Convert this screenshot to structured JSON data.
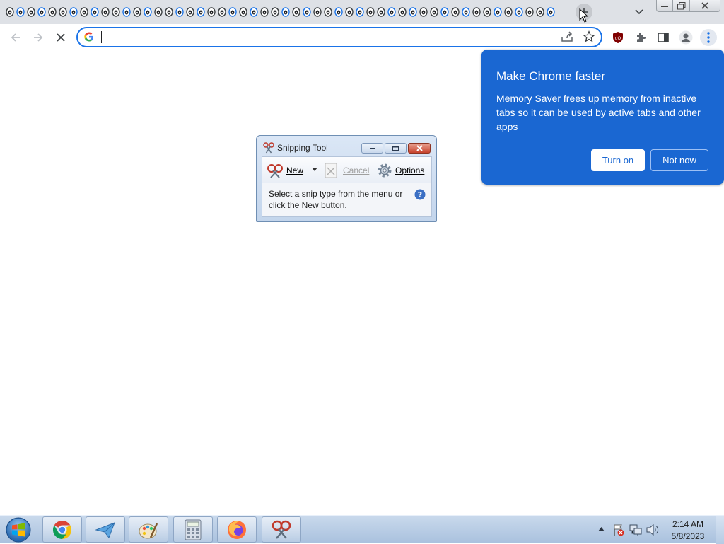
{
  "browser": {
    "tab_count": 52,
    "omnibox": {
      "value": "",
      "placeholder": ""
    }
  },
  "memory_saver": {
    "title": "Make Chrome faster",
    "body": "Memory Saver frees up memory from inactive tabs so it can be used by active tabs and other apps",
    "turn_on_label": "Turn on",
    "not_now_label": "Not now",
    "accent": "#1a67d2"
  },
  "snipping_tool": {
    "title": "Snipping Tool",
    "new_label": "New",
    "cancel_label": "Cancel",
    "options_label": "Options",
    "message": "Select a snip type from the menu or click the New button."
  },
  "taskbar": {
    "apps": [
      "chrome-icon",
      "send-app-icon",
      "paint-icon",
      "calculator-icon",
      "firefox-icon",
      "snipping-tool-icon"
    ],
    "time": "2:14 AM",
    "date": "5/8/2023"
  }
}
